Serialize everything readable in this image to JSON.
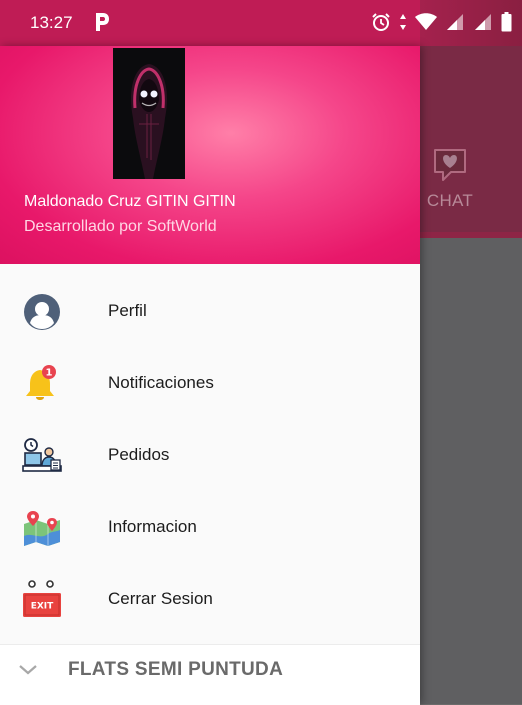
{
  "status_bar": {
    "time": "13:27"
  },
  "background": {
    "chat_tab_label": "CHAT"
  },
  "drawer": {
    "header": {
      "name": "Maldonado Cruz GITIN GITIN",
      "subtitle": "Desarrollado por SoftWorld"
    },
    "items": [
      {
        "label": "Perfil",
        "icon": "profile-icon"
      },
      {
        "label": "Notificaciones",
        "icon": "bell-icon",
        "badge": "1"
      },
      {
        "label": "Pedidos",
        "icon": "orders-icon"
      },
      {
        "label": "Informacion",
        "icon": "map-icon"
      },
      {
        "label": "Cerrar Sesion",
        "icon": "exit-icon",
        "icon_text": "EXIT"
      }
    ],
    "footer": {
      "label": "FLATS SEMI PUNTUDA"
    }
  },
  "colors": {
    "accent": "#e8186a",
    "status_bar": "#bf1c55",
    "scrim": "#5f5f61"
  }
}
